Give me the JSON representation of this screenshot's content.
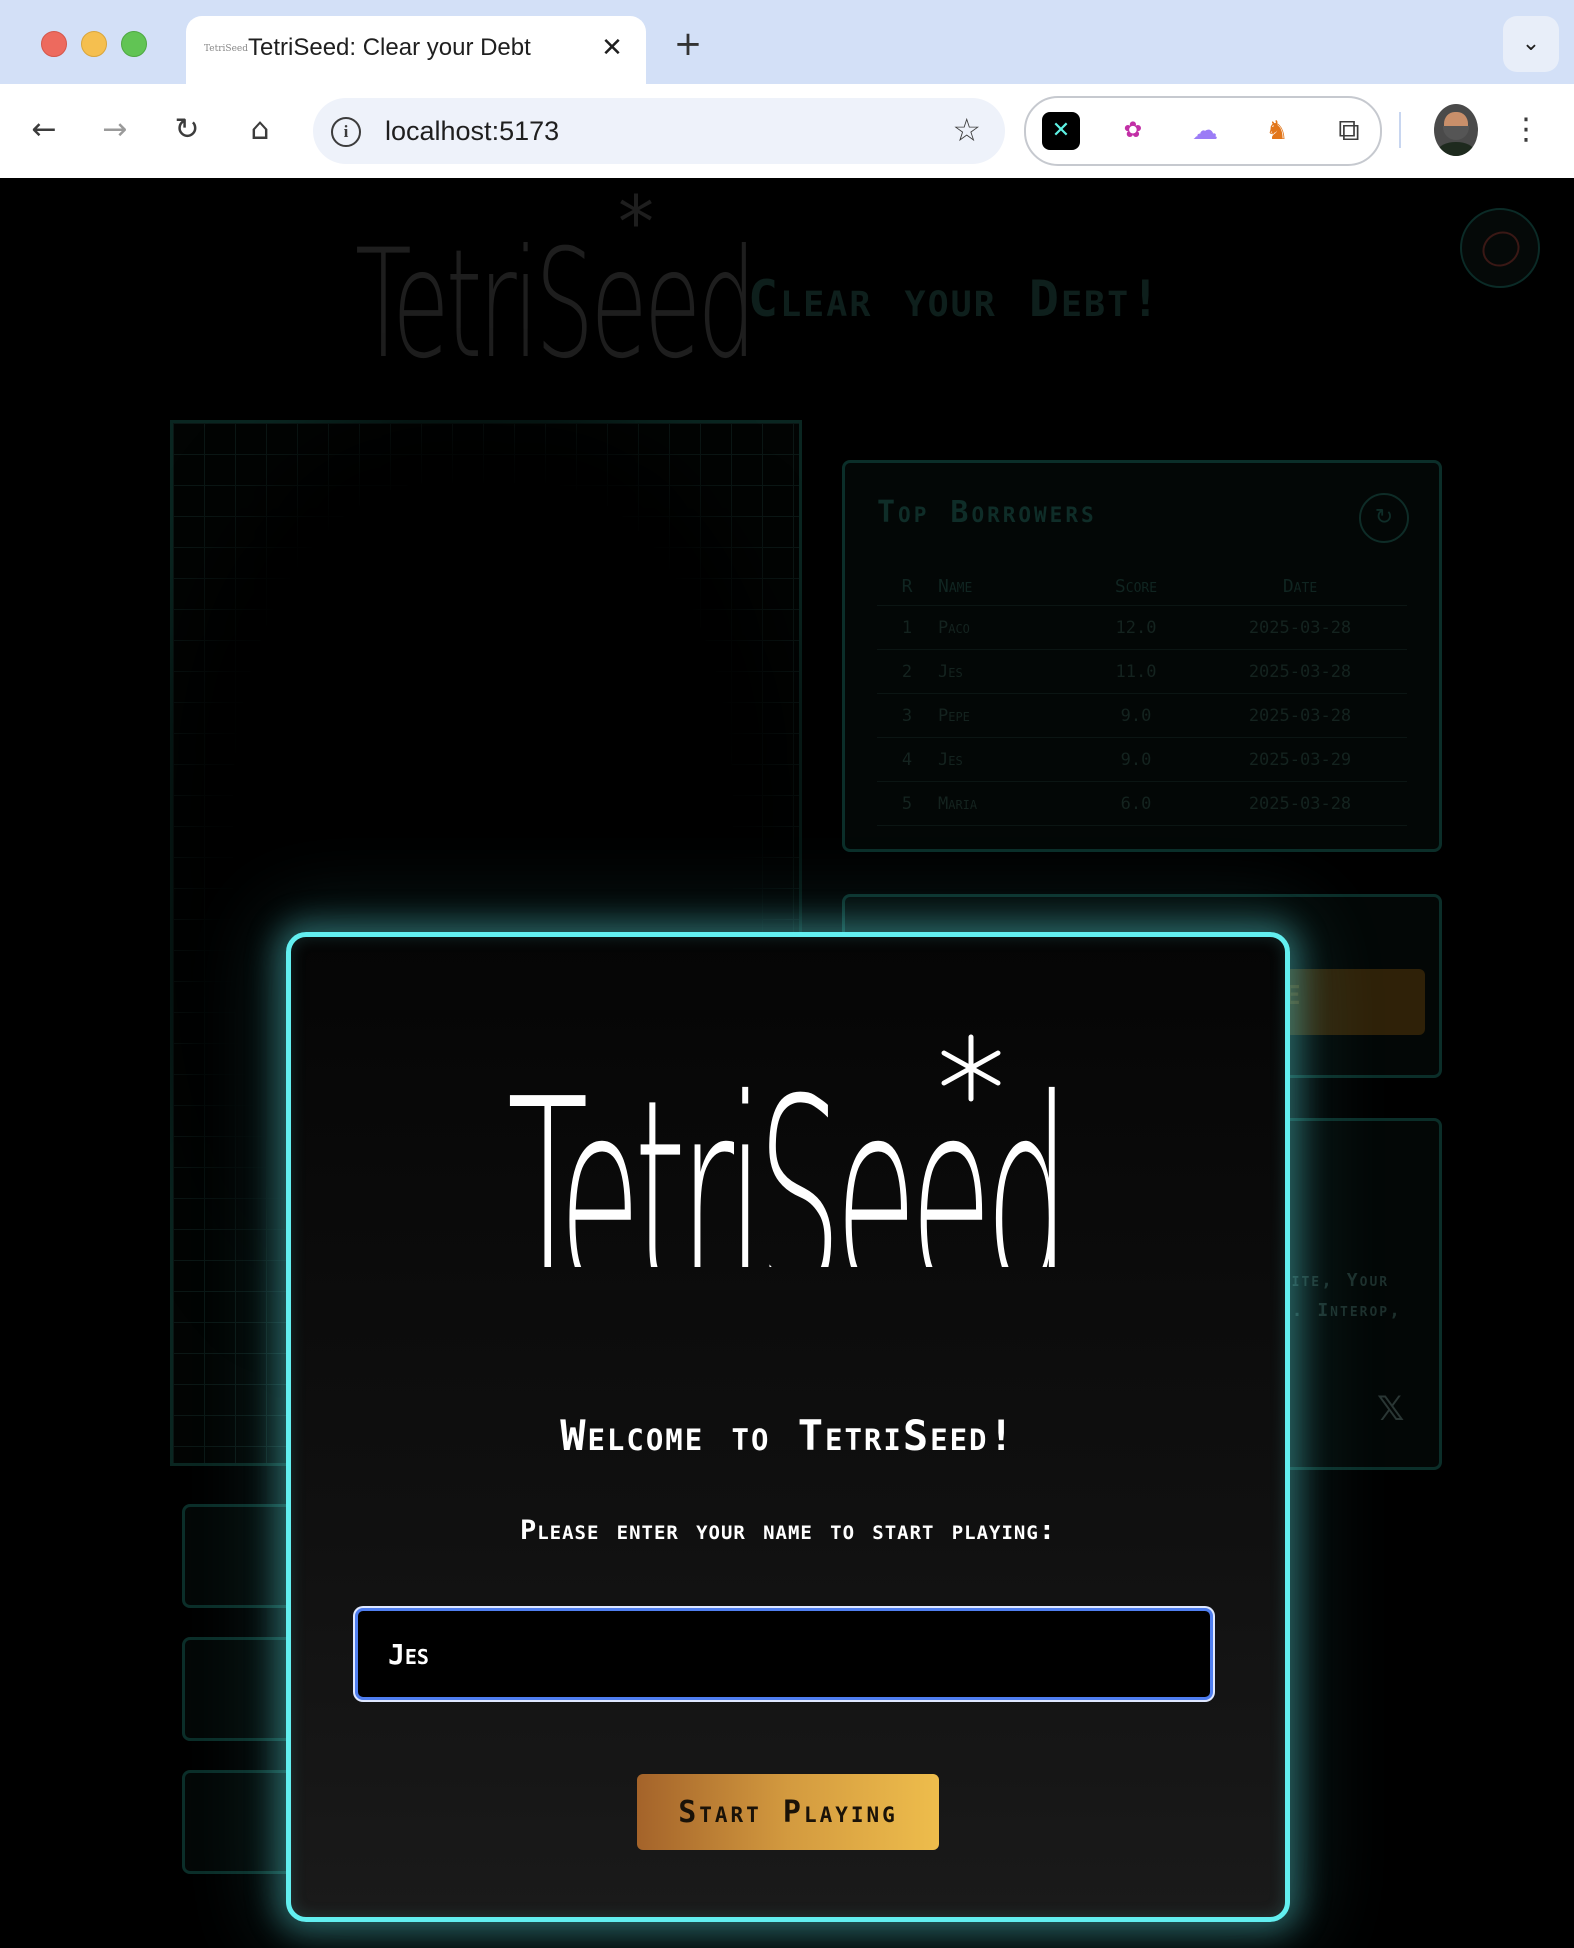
{
  "browser": {
    "tab_title": "TetriSeed: Clear your Debt",
    "tab_favicon_text": "TetriSeed",
    "tab_close": "✕",
    "new_tab": "+",
    "tab_dropdown": "⌄",
    "url": "localhost:5173",
    "nav": {
      "back": "←",
      "forward": "→",
      "reload": "↻",
      "home": "⌂"
    },
    "info_glyph": "i",
    "bookmark_glyph": "☆",
    "menu_glyph": "⋮",
    "extensions": [
      {
        "name": "x-extension-icon",
        "glyph": "✕"
      },
      {
        "name": "paw-extension-icon",
        "glyph": "✿"
      },
      {
        "name": "ghost-extension-icon",
        "glyph": "☁"
      },
      {
        "name": "metamask-fox-icon",
        "glyph": "♞"
      },
      {
        "name": "puzzle-extensions-icon",
        "glyph": "⧉"
      }
    ]
  },
  "page": {
    "logo": "TetriSeed",
    "tagline": "Clear your Debt!",
    "leaderboard": {
      "title": "Top Borrowers",
      "refresh_glyph": "↻",
      "columns": [
        "R",
        "Name",
        "Score",
        "Date"
      ],
      "rows": [
        {
          "rank": "1",
          "name": "Paco",
          "score": "12.0",
          "date": "2025-03-28"
        },
        {
          "rank": "2",
          "name": "Jes",
          "score": "11.0",
          "date": "2025-03-28"
        },
        {
          "rank": "3",
          "name": "Pepe",
          "score": "9.0",
          "date": "2025-03-28"
        },
        {
          "rank": "4",
          "name": "Jes",
          "score": "9.0",
          "date": "2025-03-29"
        },
        {
          "rank": "5",
          "name": "Maria",
          "score": "6.0",
          "date": "2025-03-28"
        }
      ]
    },
    "mid_button_fragment": "E",
    "info_fragment_1": "omite, Your",
    "info_fragment_2": "ly. Interop,",
    "x_glyph": "𝕏"
  },
  "modal": {
    "logo": "TetriSeed",
    "heading": "Welcome to TetriSeed!",
    "subheading": "Please enter your name to start playing:",
    "name_value": "Jes",
    "start_button": "Start Playing"
  },
  "colors": {
    "modal_border": "#62eff0",
    "input_border": "#4f7ef0",
    "button_gradient_start": "#a4632a",
    "button_gradient_end": "#eebd4c"
  }
}
